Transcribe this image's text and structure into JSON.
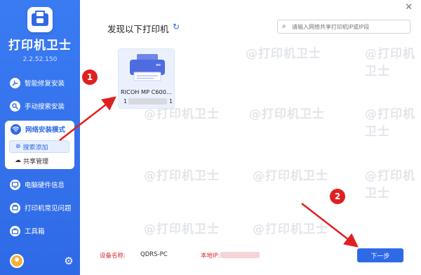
{
  "app": {
    "name": "打印机卫士",
    "version": "2.2.52.150"
  },
  "sidebar": {
    "items": [
      {
        "label": "智能修复安装",
        "icon": "repair-icon"
      },
      {
        "label": "手动搜索安装",
        "icon": "manual-search-icon"
      },
      {
        "label": "电脑硬件信息",
        "icon": "hardware-icon"
      },
      {
        "label": "打印机常见问题",
        "icon": "faq-icon"
      },
      {
        "label": "工具箱",
        "icon": "toolbox-icon"
      }
    ],
    "group": {
      "label": "网络安装模式",
      "icon": "network-icon",
      "sub_items": [
        {
          "label": "搜索添加",
          "icon": "search-icon",
          "active": true
        },
        {
          "label": "共享管理",
          "icon": "cloud-icon",
          "active": false
        }
      ]
    }
  },
  "main": {
    "title": "发现以下打印机",
    "search_placeholder": "请输入网络共享打印机IP或IP段",
    "printer": {
      "name": "RICOH MP C600...",
      "ip_prefix": "1",
      "ip_suffix": "1"
    },
    "footer": {
      "device_label": "设备名称:",
      "device_value": "QDRS-PC",
      "ip_label": "本地IP:"
    },
    "next_button": "下一步"
  },
  "annotations": {
    "step1": "1",
    "step2": "2"
  },
  "watermark_text": "@打印机卫士",
  "colors": {
    "brand": "#2f6ae6",
    "annotation": "#e02020"
  }
}
